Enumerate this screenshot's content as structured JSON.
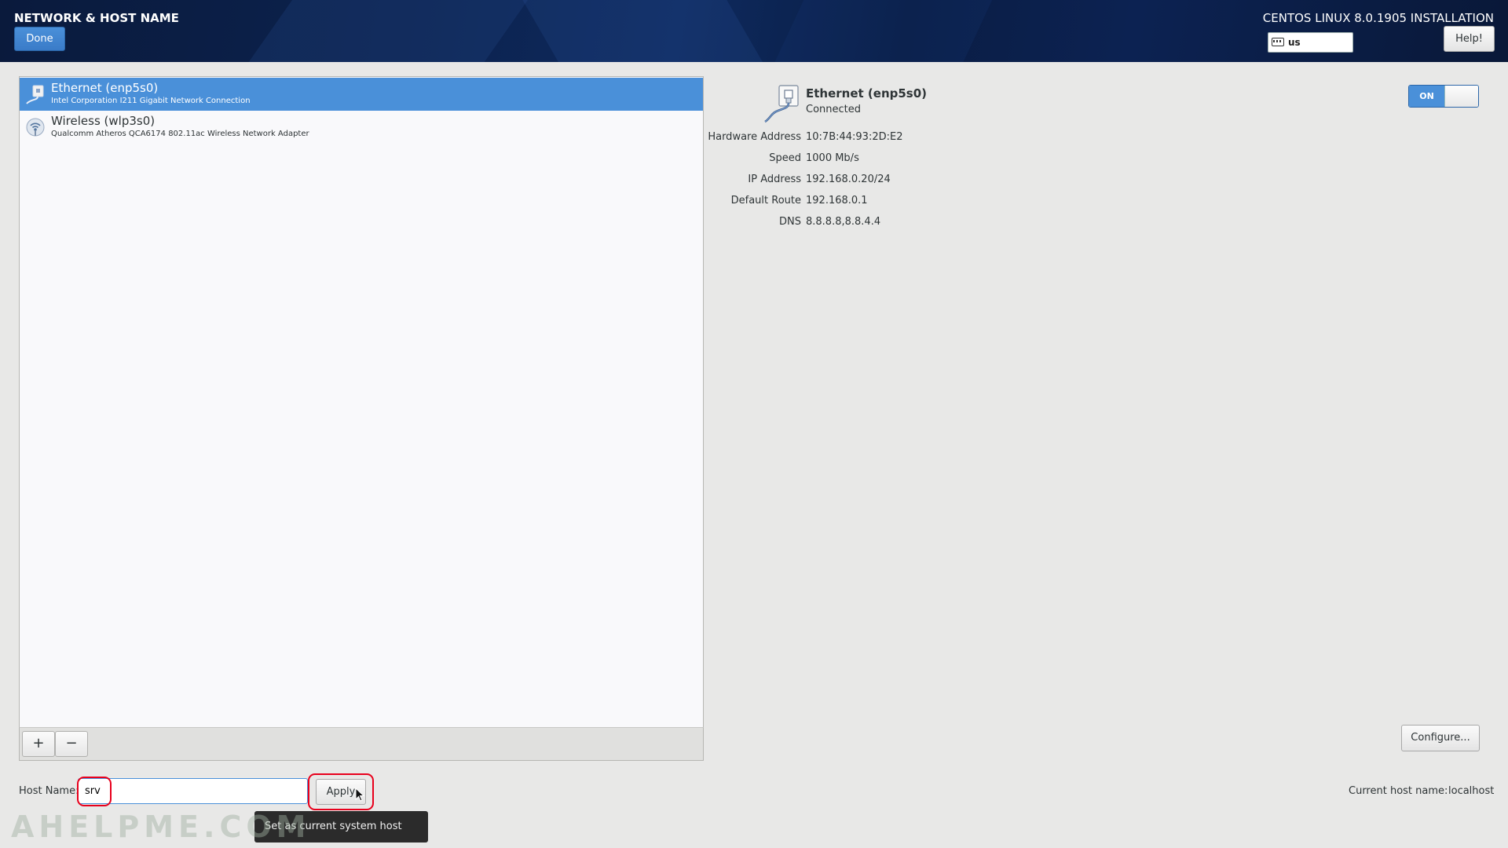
{
  "header": {
    "title": "NETWORK & HOST NAME",
    "done_label": "Done",
    "install_title": "CENTOS LINUX 8.0.1905 INSTALLATION",
    "keyboard_layout": "us",
    "help_label": "Help!"
  },
  "devices": [
    {
      "name": "Ethernet (enp5s0)",
      "description": "Intel Corporation I211 Gigabit Network Connection",
      "icon": "ethernet-icon",
      "selected": true
    },
    {
      "name": "Wireless (wlp3s0)",
      "description": "Qualcomm Atheros QCA6174 802.11ac Wireless Network Adapter",
      "icon": "wireless-icon",
      "selected": false
    }
  ],
  "toolbar": {
    "add_label": "+",
    "remove_label": "−"
  },
  "details": {
    "name": "Ethernet (enp5s0)",
    "status": "Connected",
    "toggle_label": "ON",
    "rows": [
      {
        "label": "Hardware Address",
        "value": "10:7B:44:93:2D:E2"
      },
      {
        "label": "Speed",
        "value": "1000 Mb/s"
      },
      {
        "label": "IP Address",
        "value": "192.168.0.20/24"
      },
      {
        "label": "Default Route",
        "value": "192.168.0.1"
      },
      {
        "label": "DNS",
        "value": "8.8.8.8,8.8.4.4"
      }
    ],
    "configure_label": "Configure..."
  },
  "hostname": {
    "label": "Host Name:",
    "value": "srv",
    "apply_label": "Apply",
    "tooltip": "Set as current system host name.",
    "current_label": "Current host name:",
    "current_value": "localhost"
  },
  "watermark": "AHELPME.COM",
  "colors": {
    "accent": "#4a90d9",
    "header_bg": "#0c2350",
    "highlight": "#e8001c"
  }
}
